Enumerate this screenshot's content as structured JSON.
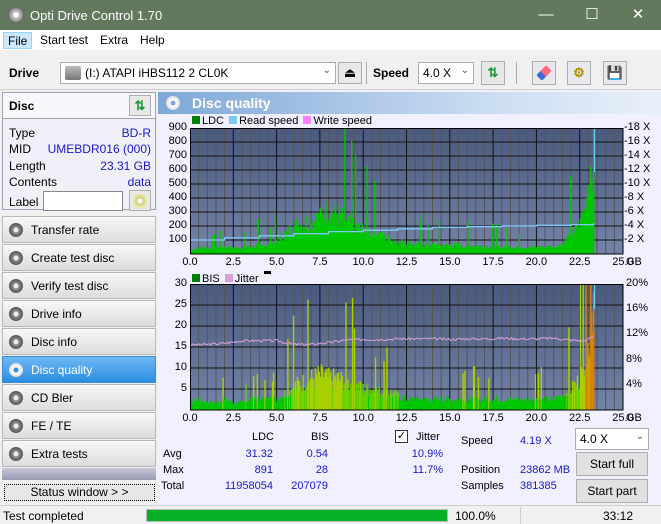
{
  "window": {
    "title": "Opti Drive Control 1.70",
    "minimize": "—",
    "maximize": "☐",
    "close": "✕"
  },
  "menu": [
    {
      "label": "File"
    },
    {
      "label": "Start test"
    },
    {
      "label": "Extra"
    },
    {
      "label": "Help"
    }
  ],
  "toolbar": {
    "drive_label": "Drive",
    "drive_value": "(I:)  ATAPI iHBS112   2 CL0K",
    "speed_label": "Speed",
    "speed_value": "4.0 X",
    "icons": [
      "eject-icon",
      "refresh-icon",
      "eraser-icon",
      "settings-icon",
      "save-icon"
    ]
  },
  "disc": {
    "header": "Disc",
    "fields": [
      {
        "key": "Type",
        "value": "BD-R"
      },
      {
        "key": "MID",
        "value": "UMEBDR016 (000)"
      },
      {
        "key": "Length",
        "value": "23.31 GB"
      },
      {
        "key": "Contents",
        "value": "data"
      }
    ],
    "label_key": "Label",
    "label_value": ""
  },
  "nav": [
    {
      "label": "Transfer rate",
      "selected": false
    },
    {
      "label": "Create test disc",
      "selected": false
    },
    {
      "label": "Verify test disc",
      "selected": false
    },
    {
      "label": "Drive info",
      "selected": false
    },
    {
      "label": "Disc info",
      "selected": false
    },
    {
      "label": "Disc quality",
      "selected": true
    },
    {
      "label": "CD Bler",
      "selected": false
    },
    {
      "label": "FE / TE",
      "selected": false
    },
    {
      "label": "Extra tests",
      "selected": false
    }
  ],
  "status_window_label": "Status window > >",
  "panel_title": "Disc quality",
  "chart_data": [
    {
      "type": "bar",
      "title": "LDC",
      "legend": [
        {
          "name": "LDC",
          "color": "#008000"
        },
        {
          "name": "Read speed",
          "color": "#80c8f8"
        },
        {
          "name": "Write speed",
          "color": "#ff80ff"
        }
      ],
      "xlabel": "GB",
      "xlim": [
        0,
        25
      ],
      "x_ticks": [
        "0.0",
        "2.5",
        "5.0",
        "7.5",
        "10.0",
        "12.5",
        "15.0",
        "17.5",
        "20.0",
        "22.5",
        "25.0"
      ],
      "ylim": [
        0,
        900
      ],
      "y_ticks": [
        "100",
        "200",
        "300",
        "400",
        "500",
        "600",
        "700",
        "800",
        "900"
      ],
      "y2lim": [
        0,
        18
      ],
      "y2_ticks": [
        "2 X",
        "4 X",
        "6 X",
        "8 X",
        "10 X",
        "12 X",
        "14 X",
        "16 X",
        "18 X"
      ],
      "grid": true,
      "series": [
        {
          "name": "LDC",
          "x": [
            0.0,
            0.5,
            0.8,
            1.0,
            1.5,
            2.0,
            2.5,
            3.0,
            3.5,
            4.0,
            4.5,
            5.0,
            5.5,
            6.0,
            6.5,
            7.0,
            7.5,
            8.0,
            8.5,
            9.0,
            9.5,
            10.0,
            10.5,
            11.0,
            11.5,
            12.0,
            12.5,
            13.0,
            13.5,
            14.0,
            14.5,
            15.0,
            15.5,
            16.0,
            16.5,
            17.0,
            17.5,
            18.0,
            18.5,
            19.0,
            19.5,
            20.0,
            20.5,
            21.0,
            21.5,
            22.0,
            22.5,
            22.8,
            23.0,
            23.2,
            23.3
          ],
          "values": [
            40,
            45,
            60,
            50,
            60,
            55,
            50,
            55,
            60,
            70,
            80,
            100,
            170,
            230,
            260,
            280,
            300,
            380,
            320,
            280,
            230,
            200,
            180,
            150,
            120,
            100,
            90,
            85,
            80,
            75,
            75,
            75,
            70,
            70,
            70,
            65,
            60,
            60,
            60,
            60,
            55,
            55,
            60,
            60,
            90,
            170,
            250,
            400,
            650,
            800,
            891
          ]
        },
        {
          "name": "Read speed",
          "x": [
            0,
            2,
            4,
            6,
            8,
            10,
            12,
            14,
            16,
            18,
            20,
            22,
            23.3
          ],
          "values": [
            2.0,
            2.3,
            2.6,
            2.9,
            3.2,
            3.4,
            3.6,
            3.8,
            3.9,
            4.0,
            4.1,
            4.2,
            4.4
          ]
        }
      ]
    },
    {
      "type": "bar",
      "title": "BIS",
      "legend": [
        {
          "name": "BIS",
          "color": "#008000"
        },
        {
          "name": "Jitter",
          "color": "#d8a0d8"
        }
      ],
      "xlabel": "GB",
      "xlim": [
        0,
        25
      ],
      "x_ticks": [
        "0.0",
        "2.5",
        "5.0",
        "7.5",
        "10.0",
        "12.5",
        "15.0",
        "17.5",
        "20.0",
        "22.5",
        "25.0"
      ],
      "ylim": [
        0,
        30
      ],
      "y_ticks": [
        "5",
        "10",
        "15",
        "20",
        "25",
        "30"
      ],
      "y2lim": [
        0,
        20
      ],
      "y2_ticks": [
        "4%",
        "8%",
        "12%",
        "16%",
        "20%"
      ],
      "grid": true,
      "series": [
        {
          "name": "BIS",
          "x": [
            0.0,
            0.5,
            1.0,
            1.5,
            2.0,
            2.5,
            3.0,
            3.5,
            4.0,
            4.5,
            5.0,
            5.5,
            6.0,
            6.5,
            7.0,
            7.5,
            8.0,
            8.5,
            9.0,
            9.5,
            10.0,
            10.5,
            11.0,
            11.5,
            12.0,
            12.5,
            13.0,
            13.5,
            14.0,
            14.5,
            15.0,
            15.5,
            16.0,
            16.5,
            17.0,
            17.5,
            18.0,
            18.5,
            19.0,
            19.5,
            20.0,
            20.5,
            21.0,
            21.5,
            22.0,
            22.5,
            22.8,
            23.0,
            23.2,
            23.3
          ],
          "values": [
            2,
            3,
            2,
            2,
            3,
            2,
            2,
            3,
            3,
            3,
            3,
            5,
            7,
            8,
            9,
            10,
            9,
            9,
            8,
            7,
            6,
            6,
            5,
            5,
            4,
            3,
            3,
            3,
            3,
            3,
            3,
            3,
            3,
            3,
            3,
            3,
            3,
            3,
            3,
            3,
            3,
            3,
            3,
            4,
            6,
            9,
            14,
            20,
            26,
            28
          ]
        },
        {
          "name": "Jitter",
          "x": [
            0,
            1,
            2,
            3,
            4,
            5,
            6,
            7,
            8,
            9,
            10,
            11,
            12,
            13,
            14,
            15,
            16,
            17,
            18,
            19,
            20,
            21,
            22,
            22.8,
            23.3
          ],
          "values": [
            10.3,
            10.4,
            10.6,
            11.0,
            11.0,
            11.0,
            10.4,
            10.4,
            10.7,
            11.1,
            11.2,
            11.2,
            11.3,
            11.3,
            11.3,
            11.2,
            11.3,
            11.3,
            11.4,
            11.3,
            11.3,
            11.4,
            11.1,
            11.0,
            11.7
          ]
        }
      ]
    }
  ],
  "stats": {
    "col_ldc": "LDC",
    "col_bis": "BIS",
    "rows": [
      {
        "label": "Avg",
        "ldc": "31.32",
        "bis": "0.54",
        "jitter": "10.9%"
      },
      {
        "label": "Max",
        "ldc": "891",
        "bis": "28",
        "jitter": "11.7%"
      },
      {
        "label": "Total",
        "ldc": "11958054",
        "bis": "207079",
        "jitter": ""
      }
    ],
    "jitter_label": "Jitter",
    "jitter_checked": true,
    "speed_label": "Speed",
    "speed_value": "4.19 X",
    "position_label": "Position",
    "position_value": "23862 MB",
    "samples_label": "Samples",
    "samples_value": "381385",
    "speed_select": "4.0 X",
    "start_full": "Start full",
    "start_part": "Start part"
  },
  "statusbar": {
    "text": "Test completed",
    "progress": 100.0,
    "progress_label": "100.0%",
    "time": "33:12"
  }
}
